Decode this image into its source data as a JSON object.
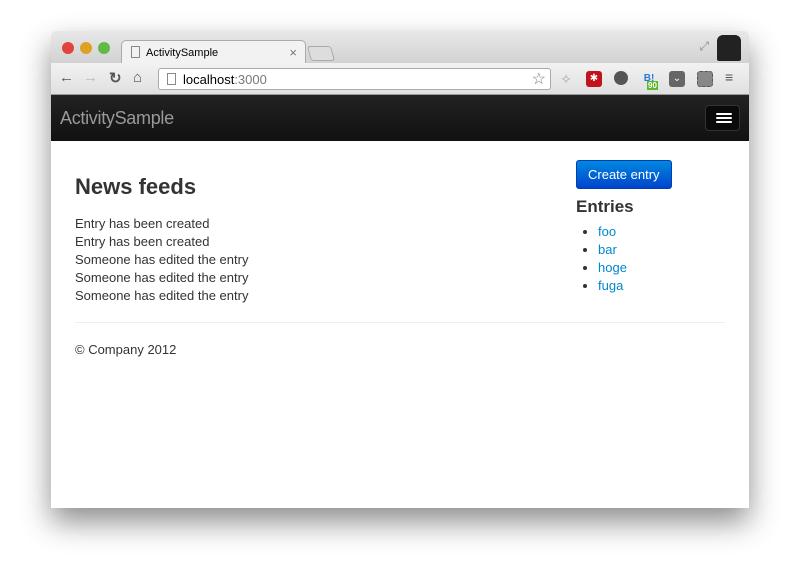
{
  "browser": {
    "tab_title": "ActivitySample",
    "tab_close": "×",
    "url_host": "localhost",
    "url_port": ":3000",
    "hatena_count": "90"
  },
  "navbar": {
    "brand": "ActivitySample"
  },
  "main": {
    "title": "News feeds",
    "feed": [
      "Entry has been created",
      "Entry has been created",
      "Someone has edited the entry",
      "Someone has edited the entry",
      "Someone has edited the entry"
    ]
  },
  "sidebar": {
    "create_label": "Create entry",
    "entries_title": "Entries",
    "entries": [
      "foo",
      "bar",
      "hoge",
      "fuga"
    ]
  },
  "footer": {
    "text": "© Company 2012"
  }
}
